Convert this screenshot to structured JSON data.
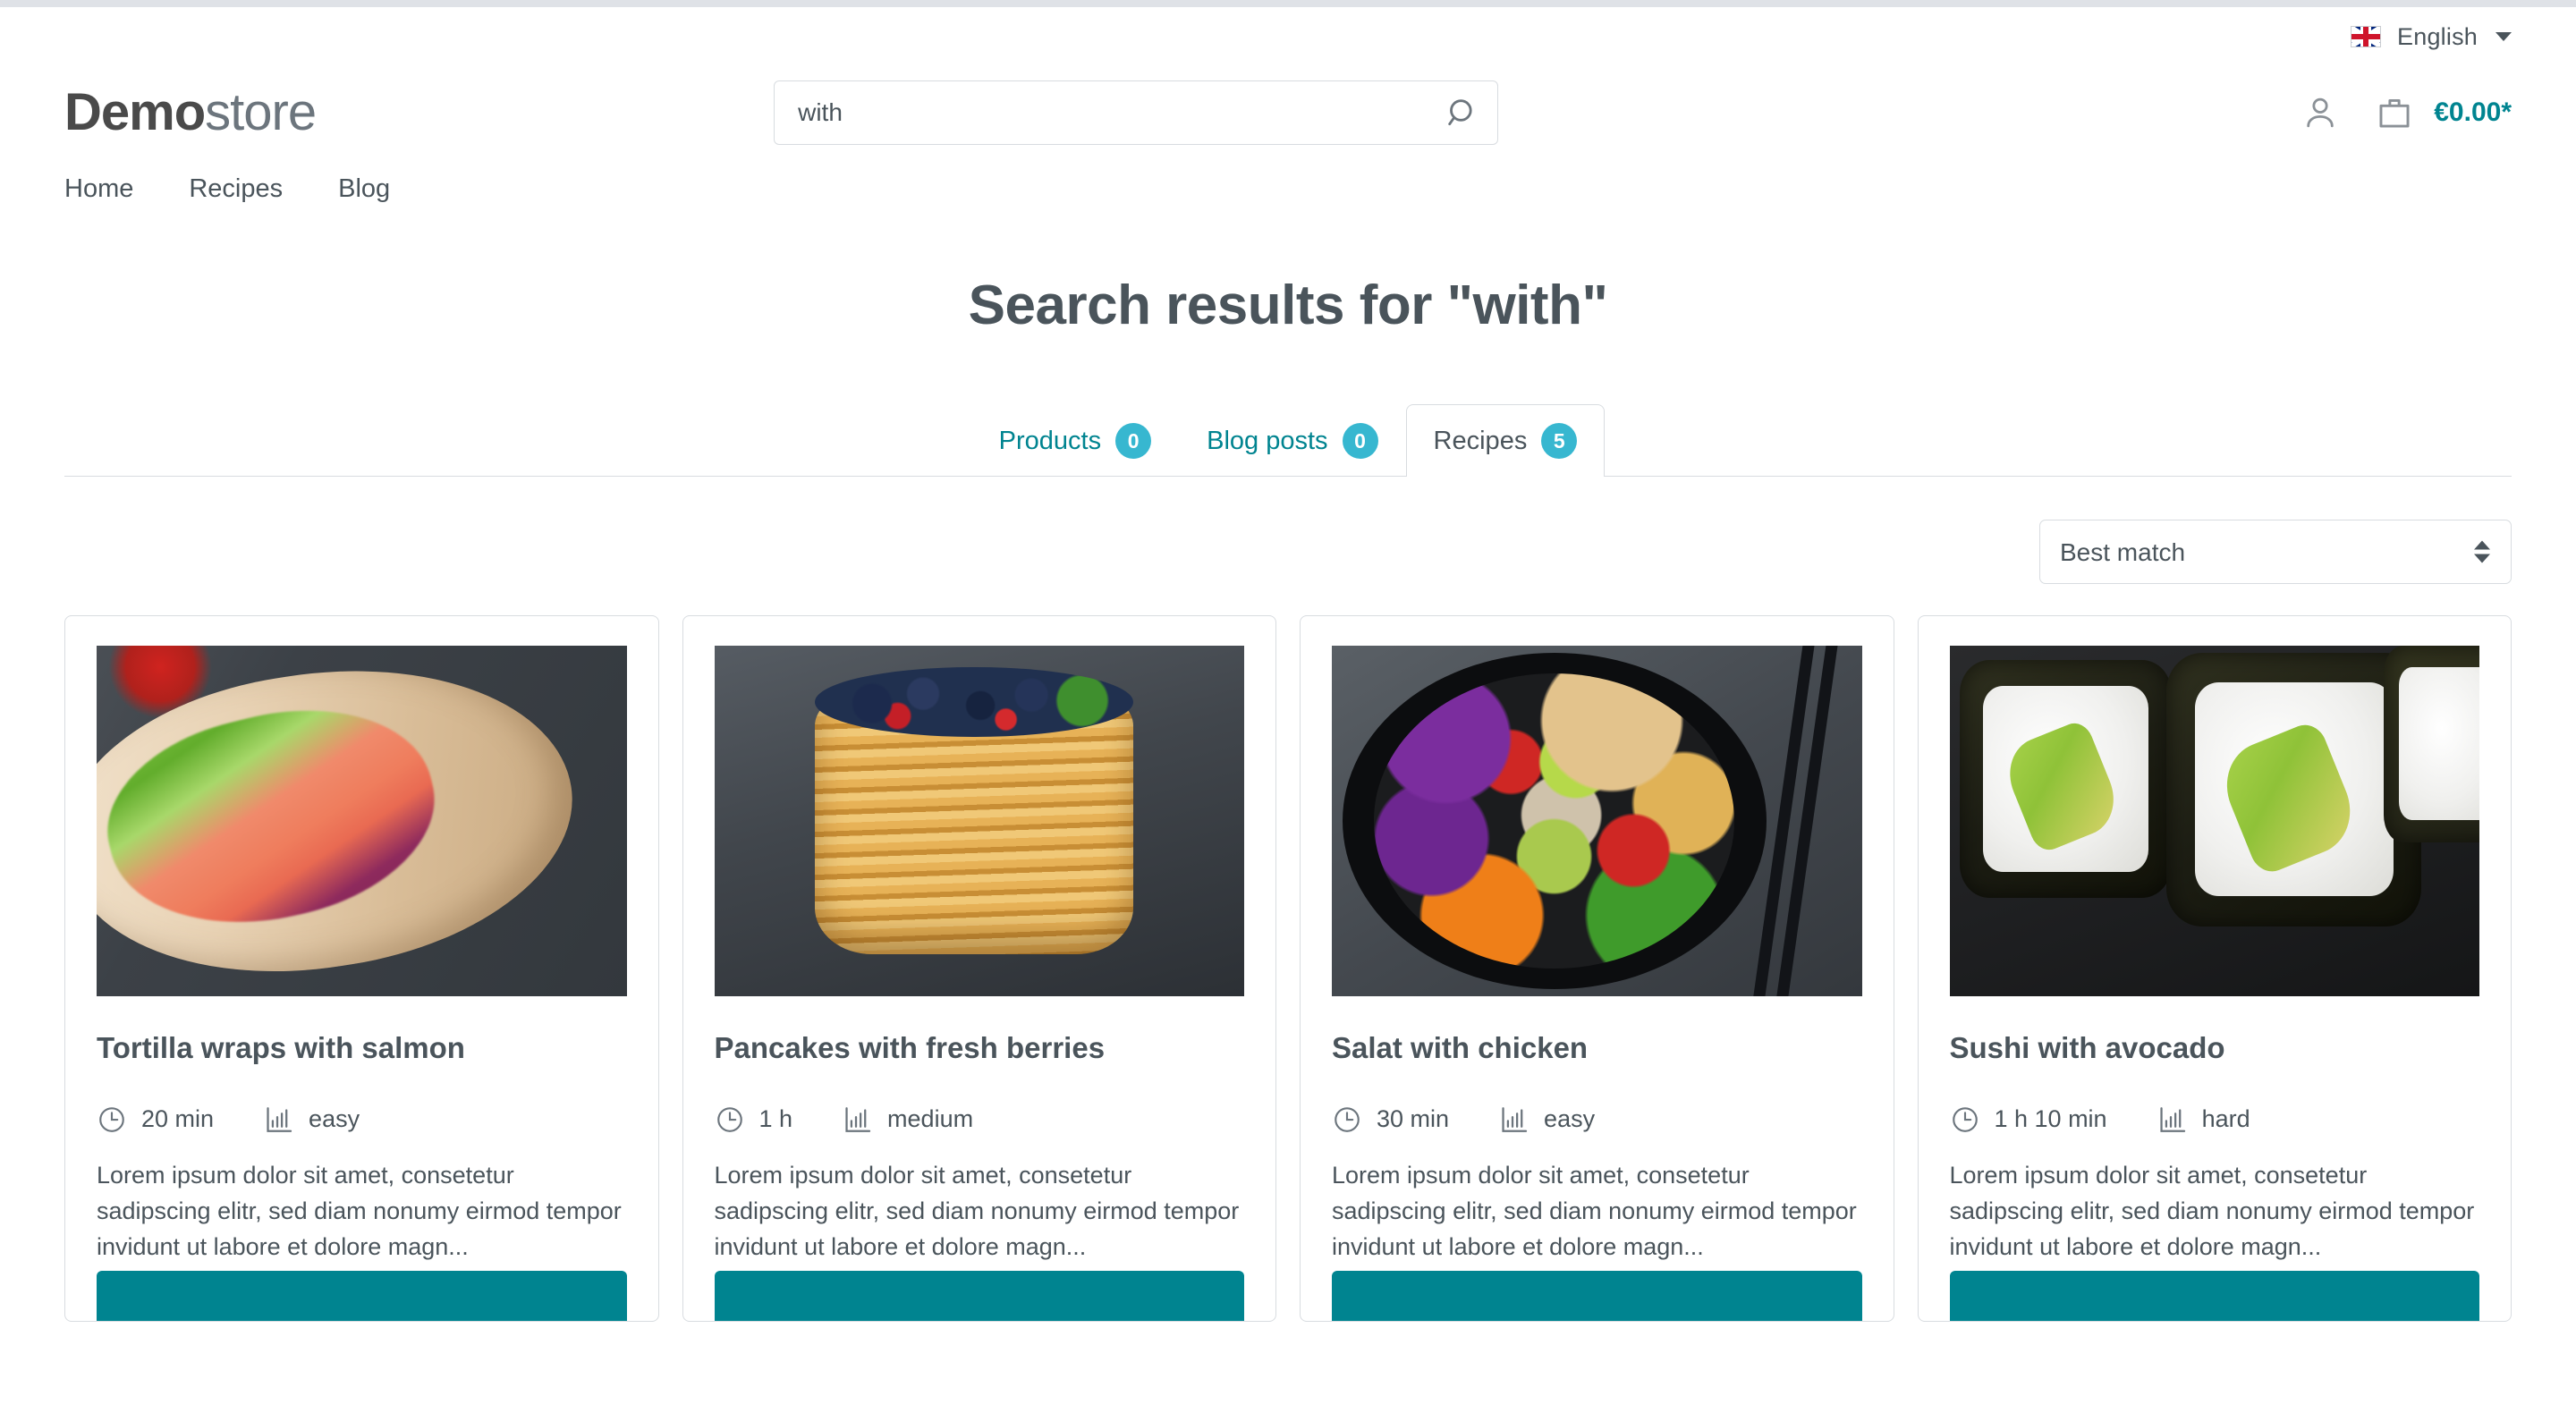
{
  "topbar": {
    "language": {
      "flag_icon": "uk-flag-icon",
      "label": "English",
      "caret_icon": "chevron-down-icon"
    }
  },
  "header": {
    "logo": {
      "bold": "Demo",
      "light": "store"
    },
    "search": {
      "value": "with",
      "placeholder": "",
      "icon": "search-icon"
    },
    "account": {
      "icon": "user-icon"
    },
    "cart": {
      "icon": "shopping-bag-icon",
      "total": "€0.00*"
    }
  },
  "mainnav": {
    "items": [
      {
        "label": "Home"
      },
      {
        "label": "Recipes"
      },
      {
        "label": "Blog"
      }
    ]
  },
  "main": {
    "title": "Search results for \"with\"",
    "tabs": [
      {
        "label": "Products",
        "count": "0",
        "active": false
      },
      {
        "label": "Blog posts",
        "count": "0",
        "active": false
      },
      {
        "label": "Recipes",
        "count": "5",
        "active": true
      }
    ],
    "sorting": {
      "selected": "Best match",
      "options": [
        "Best match"
      ],
      "arrows_icon": "sort-arrows-icon"
    },
    "cards": [
      {
        "title": "Tortilla wraps with salmon",
        "time": "20 min",
        "difficulty": "easy",
        "time_icon": "clock-icon",
        "difficulty_icon": "bar-chart-icon",
        "description": "Lorem ipsum dolor sit amet, consetetur sadipscing elitr, sed diam nonumy eirmod tempor invidunt ut labore et dolore magn...",
        "image_alt": "tortilla-wrap-photo"
      },
      {
        "title": "Pancakes with fresh berries",
        "time": "1 h",
        "difficulty": "medium",
        "time_icon": "clock-icon",
        "difficulty_icon": "bar-chart-icon",
        "description": "Lorem ipsum dolor sit amet, consetetur sadipscing elitr, sed diam nonumy eirmod tempor invidunt ut labore et dolore magn...",
        "image_alt": "pancake-stack-photo"
      },
      {
        "title": "Salat with chicken",
        "time": "30 min",
        "difficulty": "easy",
        "time_icon": "clock-icon",
        "difficulty_icon": "bar-chart-icon",
        "description": "Lorem ipsum dolor sit amet, consetetur sadipscing elitr, sed diam nonumy eirmod tempor invidunt ut labore et dolore magn...",
        "image_alt": "salad-bowl-photo"
      },
      {
        "title": "Sushi with avocado",
        "time": "1 h 10 min",
        "difficulty": "hard",
        "time_icon": "clock-icon",
        "difficulty_icon": "bar-chart-icon",
        "description": "Lorem ipsum dolor sit amet, consetetur sadipscing elitr, sed diam nonumy eirmod tempor invidunt ut labore et dolore magn...",
        "image_alt": "sushi-rolls-photo"
      }
    ]
  },
  "colors": {
    "accent_teal": "#008490",
    "badge_teal": "#37b7d0",
    "text": "#4a545b",
    "border": "#d8dce0"
  }
}
